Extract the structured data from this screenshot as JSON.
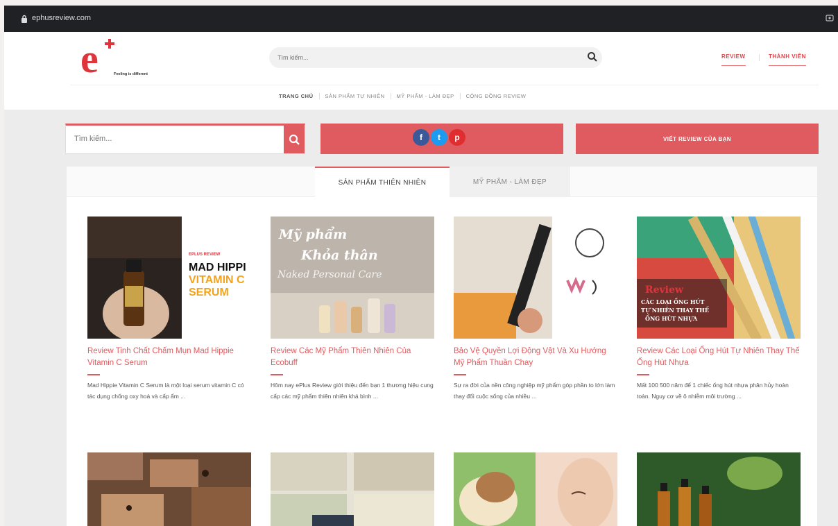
{
  "browser": {
    "url": "ephusreview.com"
  },
  "header": {
    "tagline": "Feeling is different",
    "search_placeholder": "Tìm kiếm...",
    "review_link": "REVIEW",
    "member_link": "THÀNH VIÊN",
    "nav": [
      "TRANG CHỦ",
      "SẢN PHẨM TỰ NHIÊN",
      "MỸ PHẨM - LÀM ĐẸP",
      "CỘNG ĐỒNG REVIEW"
    ]
  },
  "actions": {
    "search_placeholder": "Tìm kiếm...",
    "write_review": "VIẾT REVIEW CỦA BẠN",
    "social": [
      "f",
      "t",
      "p"
    ]
  },
  "tabs": [
    "SẢN PHẨM THIÊN NHIÊN",
    "MỸ PHẨM - LÀM ĐẸP"
  ],
  "cards": [
    {
      "title": "Review Tinh Chất Chấm Mụn Mad Hippie Vitamin C Serum",
      "excerpt": "Mad Hippie Vitamin C Serum là một loại serum vitamin C có tác dụng chống oxy hoá và cấp ẩm ...",
      "image_text": {
        "label": "EPLUS REVIEW",
        "line1": "MAD HIPPI",
        "line2": "VITAMIN C",
        "line3": "SERUM"
      }
    },
    {
      "title": "Review Các Mỹ Phẩm Thiên Nhiên Của Ecobuff",
      "excerpt": "Hôm nay ePlus Review giới thiệu đến bạn 1 thương hiệu cung cấp các mỹ phẩm thiên nhiên khá bình ...",
      "image_text": {
        "line1": "Mỹ phẩm",
        "line2": "Khỏa thân",
        "line3": "Naked Personal Care"
      }
    },
    {
      "title": "Bảo Vệ Quyền Lợi Động Vật Và Xu Hướng Mỹ Phẩm Thuần Chay",
      "excerpt": "Sự ra đời của nền công nghiệp mỹ phẩm góp phần to lớn làm thay đổi cuộc sống của nhiều ...",
      "image_text": {}
    },
    {
      "title": "Review Các Loại Ống Hút Tự Nhiên Thay Thế Ống Hút Nhựa",
      "excerpt": "Mất 100 500 năm để 1 chiếc ống hút nhựa phân hủy hoàn toàn. Nguy cơ về ô nhiễm môi trường ...",
      "image_text": {
        "line1": "Review",
        "line2": "CÁC LOẠI ỐNG HÚT",
        "line3": "TỰ NHIÊN THAY THẾ",
        "line4": "ỐNG HÚT NHỰA"
      }
    }
  ],
  "colors": {
    "accent": "#e05b5f",
    "dark_bar": "#202124"
  }
}
